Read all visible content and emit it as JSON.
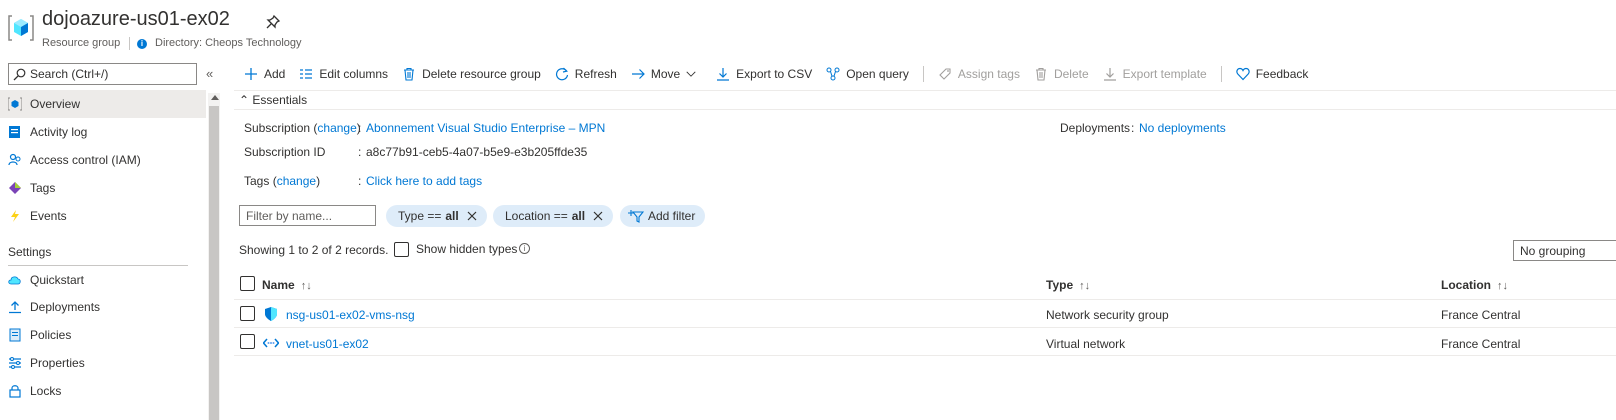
{
  "header": {
    "title": "dojoazure-us01-ex02",
    "resource_type": "Resource group",
    "directory": "Directory: Cheops Technology"
  },
  "sidebar": {
    "search_placeholder": "Search (Ctrl+/)",
    "collapse": "«",
    "items": [
      {
        "label": "Overview",
        "icon": "resource-group-icon"
      },
      {
        "label": "Activity log",
        "icon": "activity-log-icon"
      },
      {
        "label": "Access control (IAM)",
        "icon": "people-icon"
      },
      {
        "label": "Tags",
        "icon": "tag-icon"
      },
      {
        "label": "Events",
        "icon": "lightning-icon"
      }
    ],
    "section_settings": "Settings",
    "settings_items": [
      {
        "label": "Quickstart",
        "icon": "cloud-icon"
      },
      {
        "label": "Deployments",
        "icon": "upload-icon"
      },
      {
        "label": "Policies",
        "icon": "policy-icon"
      },
      {
        "label": "Properties",
        "icon": "sliders-icon"
      },
      {
        "label": "Locks",
        "icon": "lock-icon"
      }
    ]
  },
  "toolbar": {
    "add": "Add",
    "edit_columns": "Edit columns",
    "delete_rg": "Delete resource group",
    "refresh": "Refresh",
    "move": "Move",
    "export_csv": "Export to CSV",
    "open_query": "Open query",
    "assign_tags": "Assign tags",
    "delete": "Delete",
    "export_template": "Export template",
    "feedback": "Feedback"
  },
  "essentials": {
    "title": "Essentials",
    "subscription_label": "Subscription",
    "change": "change",
    "subscription_value": "Abonnement Visual Studio Enterprise – MPN",
    "subscription_id_label": "Subscription ID",
    "subscription_id_value": "a8c77b91-ceb5-4a07-b5e9-e3b205ffde35",
    "tags_label": "Tags",
    "tags_value": "Click here to add tags",
    "deployments_label": "Deployments",
    "deployments_value": "No deployments",
    "colon": ":"
  },
  "filters": {
    "name_placeholder": "Filter by name...",
    "type_prefix": "Type ==",
    "type_value": "all",
    "location_prefix": "Location ==",
    "location_value": "all",
    "add_filter": "Add filter"
  },
  "records": {
    "showing": "Showing 1 to 2 of 2 records.",
    "show_hidden": "Show hidden types",
    "group_by": "No grouping"
  },
  "table": {
    "columns": [
      "Name",
      "Type",
      "Location"
    ],
    "rows": [
      {
        "name": "nsg-us01-ex02-vms-nsg",
        "type": "Network security group",
        "location": "France Central",
        "icon": "shield-icon"
      },
      {
        "name": "vnet-us01-ex02",
        "type": "Virtual network",
        "location": "France Central",
        "icon": "vnet-icon"
      }
    ]
  },
  "colors": {
    "accent": "#0078d4",
    "pill_bg": "#deecf9",
    "nav_active": "#edebe9"
  }
}
